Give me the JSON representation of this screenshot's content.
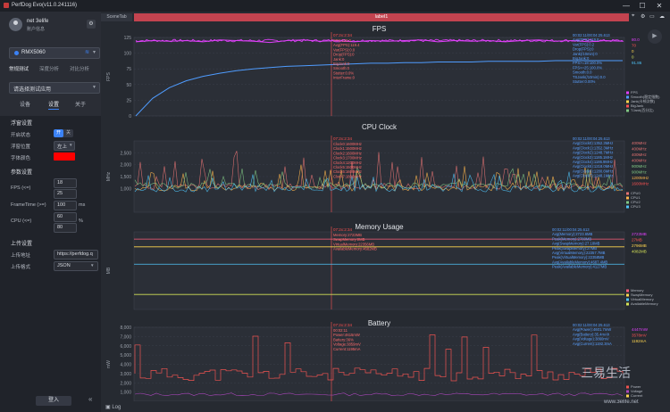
{
  "window": {
    "title": "PerfDog Evo(v11.0.241116)",
    "min": "—",
    "max": "☐",
    "close": "✕"
  },
  "user": {
    "name": "net 3elife",
    "account": "账户信息"
  },
  "device": {
    "name": "RMX5060"
  },
  "modes": [
    "常规测试",
    "深度分析",
    "对比分析"
  ],
  "app_select": "请选择测试应用",
  "tabs": [
    "设备",
    "设置",
    "关于"
  ],
  "settings": {
    "float_title": "浮窗设置",
    "float_state_label": "开启状态",
    "on": "开",
    "off": "关",
    "float_pos_label": "浮窗位置",
    "float_pos": "左上",
    "font_color_label": "字体颜色",
    "font_color": "#ff0000",
    "params_title": "参数设置",
    "fps_label": "FPS (<=)",
    "fps_v1": "18",
    "fps_v2": "25",
    "ft_label": "FrameTime (>=)",
    "ft_v": "100",
    "ft_unit": "ms",
    "cpu_label": "CPU (<=)",
    "cpu_v1": "60",
    "cpu_v2": "80",
    "cpu_unit": "%",
    "upload_title": "上传设置",
    "upload_addr_label": "上传地址",
    "upload_addr": "https://perfdog.q",
    "upload_fmt_label": "上传格式",
    "upload_fmt": "JSON"
  },
  "login": "登入",
  "main": {
    "scene_tab": "SceneTab",
    "label": "label1",
    "log": "Log"
  },
  "watermark": {
    "big": "三易生活",
    "small": "www.3elife.net"
  },
  "colors": {
    "accent": "#3b82f6",
    "label_bar": "#c3434f",
    "fps_line": "#e040fb",
    "marker": "#ff5252"
  },
  "chart_data": [
    {
      "type": "line",
      "title": "FPS",
      "ylabel": "FPS",
      "ylim": [
        0,
        125
      ],
      "yticks": [
        0,
        25,
        50,
        75,
        100,
        125
      ],
      "series": [
        {
          "name": "FPS",
          "color": "#e040fb",
          "values": [
            118,
            120,
            119,
            120,
            118,
            121,
            120,
            119,
            117,
            120,
            121,
            119,
            120,
            118,
            120,
            119,
            120,
            121,
            118,
            120,
            119,
            120,
            118,
            120,
            121,
            119,
            120,
            118,
            120,
            119
          ]
        },
        {
          "name": "SmoothIndex",
          "color": "#4f9cff",
          "values": [
            0,
            28,
            45,
            56,
            63,
            68,
            72,
            75,
            77,
            79,
            80,
            81,
            82,
            83,
            84,
            84,
            85,
            85,
            86,
            86,
            86,
            87,
            87,
            87,
            87,
            88,
            88,
            88,
            88,
            88
          ]
        }
      ],
      "legend": [
        "FPS",
        "Smooth(稳定指数)",
        "Jank(卡顿次数)",
        "BigJank",
        "TJank(百分比)"
      ],
      "marker_label": "07:2x:2:34",
      "marker_stats": [
        "FPS:120.0",
        "Avg(FPS):119.4",
        "Var(FPS):0.0",
        "Drop(FPS):0",
        "Jank:0",
        "BigJank:0",
        "Smooth:0",
        "Stutter:0.0%",
        "InterFrame:0"
      ],
      "summary_stats": [
        "00:02:11/00:04:25.613",
        "Avg(FPS):119.8",
        "Var(FPS):0.2",
        "Drop(FPS):0",
        "Jank(/10min):0",
        "BigJank:0",
        "FPS>=18:100.0%",
        "FPS>=25:100.0%",
        "Smooth:0.0",
        "TSJank(/10min):0.0",
        "Stutter:0.00%"
      ],
      "legend_values": [
        "80.0",
        "70",
        "0",
        "0",
        "91.86"
      ]
    },
    {
      "type": "line",
      "title": "CPU Clock",
      "ylabel": "MHz",
      "ylim": [
        0,
        3000
      ],
      "yticks": [
        1000,
        1500,
        2000,
        2500
      ],
      "series": [
        {
          "name": "CPU0",
          "color": "#e57373",
          "seed": 1,
          "base": 950,
          "amp": 1600
        },
        {
          "name": "CPU1",
          "color": "#ffb74d",
          "seed": 2,
          "base": 900,
          "amp": 900
        },
        {
          "name": "CPU2",
          "color": "#81c784",
          "seed": 3,
          "base": 1000,
          "amp": 800
        },
        {
          "name": "CPU3",
          "color": "#4fc3f7",
          "seed": 4,
          "base": 850,
          "amp": 700
        }
      ],
      "marker_label": "07:2x:2:34",
      "marker_stats": [
        "Clock0:1600MHz",
        "Clock1:1500MHz",
        "Clock2:1600MHz",
        "Clock3:1700MHz",
        "Clock4:1200MHz",
        "Clock5:1500MHz",
        "Clock6:1600MHz",
        "Clock7:1800MHz"
      ],
      "summary_stats": [
        "00:02:11/00:04:25.613",
        "Avg(Clock0):1352.3MHz",
        "Avg(Clock1):1352.3MHz",
        "Avg(Clock2):1248.7MHz",
        "Avg(Clock3):1185.1MHz",
        "Avg(Clock4):1186.9MHz",
        "Avg(Clock5):1218.0MHz",
        "Avg(Clock6):1280.6MHz",
        "Avg(Clock7):1248.1MHz"
      ],
      "legend_values": [
        "400MHz",
        "400MHz",
        "400MHz",
        "400MHz",
        "900MHz",
        "900MHz",
        "1200MHz",
        "1600MHz"
      ]
    },
    {
      "type": "line",
      "title": "Memory Usage",
      "ylabel": "MB",
      "ylim": [
        0,
        3000
      ],
      "series": [
        {
          "name": "Memory",
          "color": "#ff5e7a",
          "level": 2720
        },
        {
          "name": "SwapMemory",
          "color": "#ffd54f",
          "level": 2420
        },
        {
          "name": "VirtualMemory",
          "color": "#4fc3f7",
          "level": 1750
        },
        {
          "name": "AvailableMemory",
          "color": "#d4e157",
          "level": 580
        }
      ],
      "legend": [
        "Memory",
        "SwapMemory",
        "VirtualMemory",
        "AvailableMemory"
      ],
      "marker_label": "07:2x:2:34",
      "marker_stats": [
        "Memory:2723MB",
        "SwapMemory:0MB",
        "VirtualMemory:22356MB",
        "AvailableMemory:4682MB"
      ],
      "summary_stats": [
        "00:02:11/00:04:25.613",
        "Avg(Memory):2723.6MB",
        "Peak(Memory):2780MB",
        "Avg(SwapMemory):27.18MB",
        "Peak(SwapMemory):27MB",
        "Avg(VirtualMemory):22357.7MB",
        "Peak(VirtualMemory):22358MB",
        "Avg(AvailableMemory):4687.4MB",
        "Peak(AvailableMemory):4127MB"
      ],
      "legend_values": [
        "2723MB",
        "27MB",
        "2796MB",
        "4082MB"
      ]
    },
    {
      "type": "line",
      "title": "Battery",
      "ylabel": "mW",
      "ylim": [
        0,
        8000
      ],
      "yticks": [
        1000,
        2000,
        3000,
        4000,
        5000,
        6000,
        7000,
        8000
      ],
      "series": [
        {
          "name": "Power",
          "color": "#ef5350"
        },
        {
          "name": "Current",
          "color": "#ab47bc"
        }
      ],
      "legend": [
        "Power",
        "Voltage",
        "Current"
      ],
      "marker_label": "07:2x:2:34",
      "marker_stats": [
        "00:02:11",
        "Power:4615mW",
        "Battery:36%",
        "Voltage:3859mV",
        "Current:1195mA"
      ],
      "summary_stats": [
        "00:02:11/00:04:25.613",
        "Avg(Power):4601.7mW",
        "Avg(Battery):35.4mAh",
        "Avg(Voltage):3860mV",
        "Avg(Current):1192.3mA"
      ],
      "legend_values": [
        "4447mW",
        "3578mV",
        "1192mA",
        ""
      ]
    }
  ]
}
